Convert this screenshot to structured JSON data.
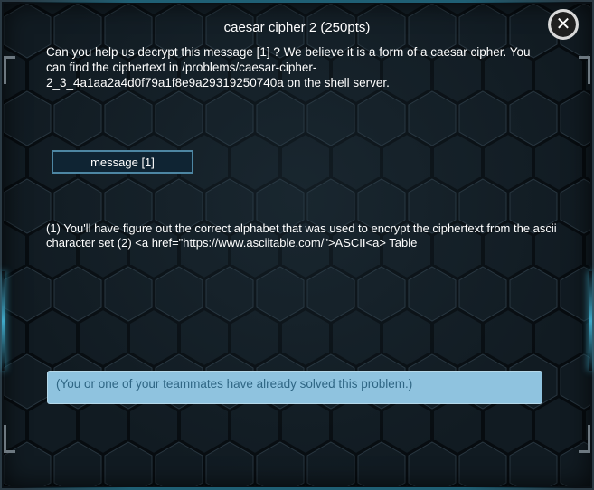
{
  "modal": {
    "title": "caesar cipher 2 (250pts)",
    "close_glyph": "✕",
    "close_icon": "close-icon",
    "description": "Can you help us decrypt this message [1] ? We believe it is a form of a caesar cipher. You can find the ciphertext in /problems/caesar-cipher-2_3_4a1aa2a4d0f79a1f8e9a29319250740a on the shell server.",
    "message_button_label": "message [1]",
    "hint_text": "(1) You'll have figure out the correct alphabet that was used to encrypt the ciphertext from the ascii character set (2) <a href=\"https://www.asciitable.com/\">ASCII<a> Table",
    "solved_notice": "(You or one of your teammates have already solved this problem.)"
  },
  "colors": {
    "background": "#111b22",
    "accent_glow": "#3fa9c9",
    "button_border": "#4d86a3",
    "notice_bg": "#8fc3df",
    "notice_text": "#2f6684"
  }
}
